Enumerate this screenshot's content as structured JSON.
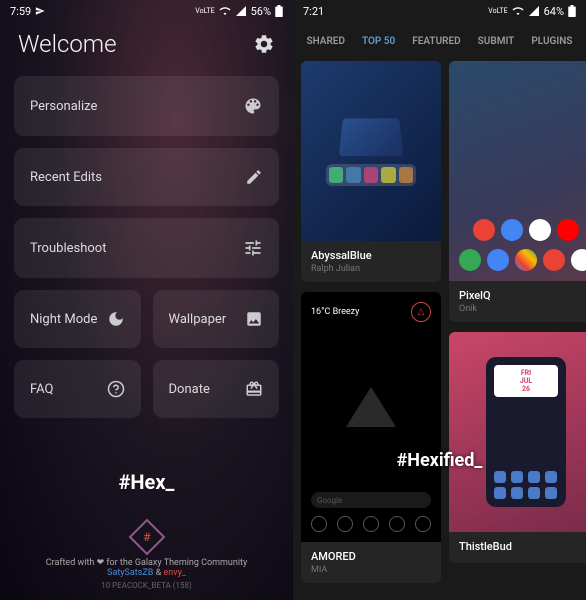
{
  "left": {
    "status": {
      "time": "7:59",
      "battery": "56%",
      "network": "VoLTE"
    },
    "title": "Welcome",
    "menu": {
      "personalize": "Personalize",
      "recent_edits": "Recent Edits",
      "troubleshoot": "Troubleshoot",
      "night_mode": "Night Mode",
      "wallpaper": "Wallpaper",
      "faq": "FAQ",
      "donate": "Donate"
    },
    "brand": "#Hex_",
    "credit_prefix": "Crafted with ❤ for the Galaxy Theming Community",
    "credit_author1": "SatySatsZB",
    "credit_amp": " & ",
    "credit_author2": "envy_",
    "version": "10 PEACOCK_BETA (158)"
  },
  "right": {
    "status": {
      "time": "7:21",
      "battery": "64%",
      "network": "VoLTE"
    },
    "tabs": {
      "shared": "SHARED",
      "top50": "TOP 50",
      "featured": "FEATURED",
      "submit": "SUBMIT",
      "plugins": "PLUGINS"
    },
    "themes": {
      "abyssal": {
        "name": "AbyssalBlue",
        "author": "Ralph Julian"
      },
      "amored": {
        "name": "AMORED",
        "author": "MIA",
        "weather": "16°C Breezy",
        "search": "Google"
      },
      "pixel": {
        "name": "PixelQ",
        "author": "Onik"
      },
      "thistle": {
        "name": "ThistleBud",
        "author": "",
        "widget_day": "FRI",
        "widget_month": "JUL",
        "widget_date": "26"
      }
    },
    "brand": "#Hexified_"
  }
}
